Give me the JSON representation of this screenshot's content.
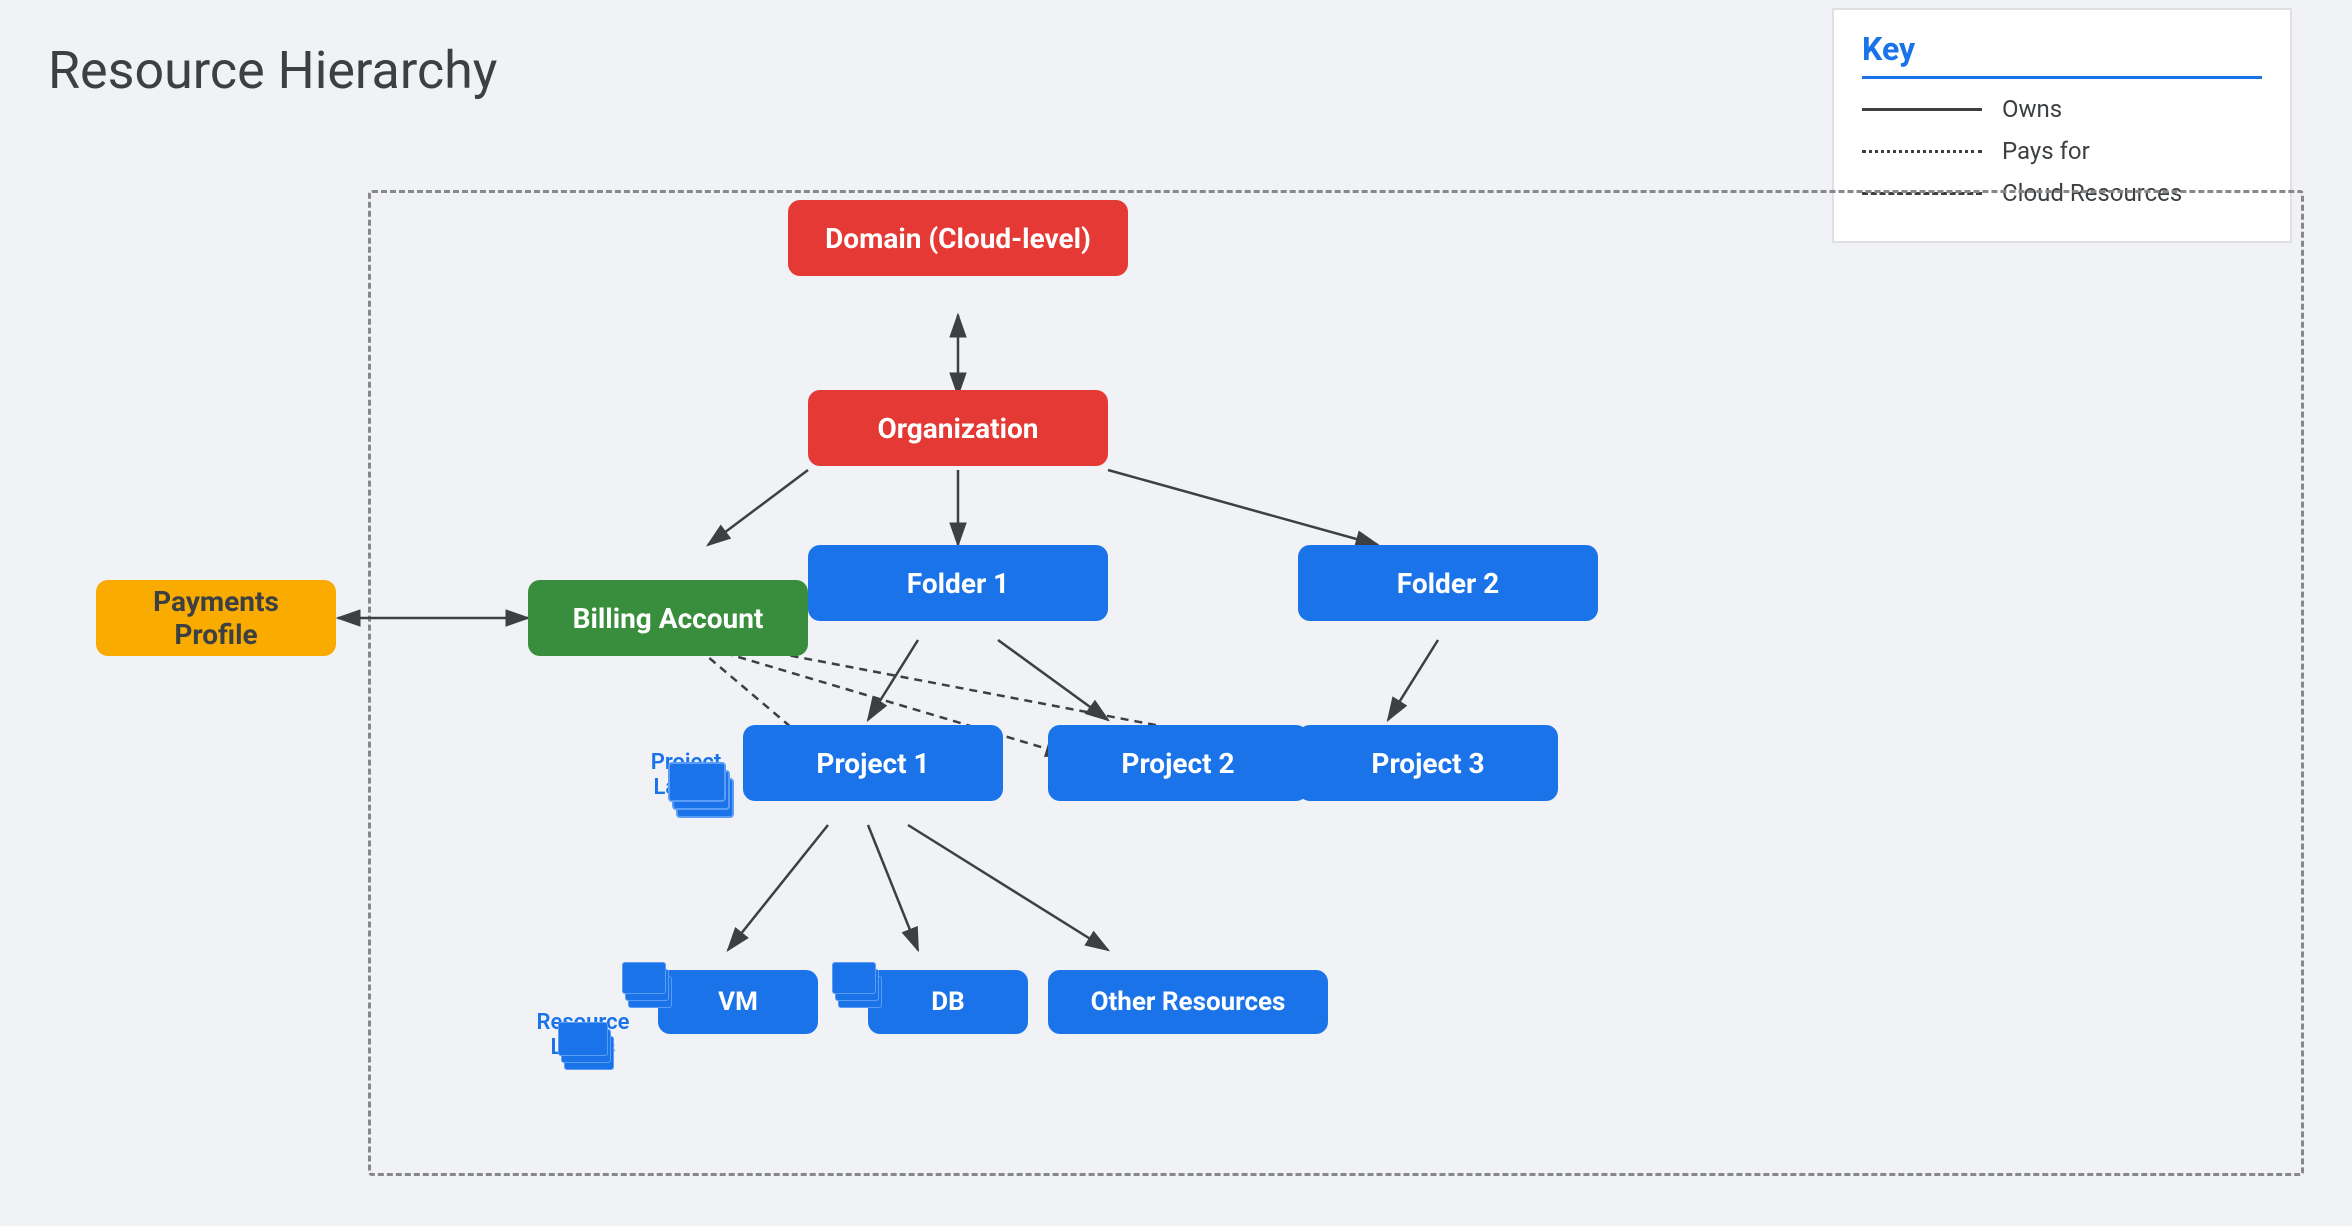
{
  "title": "Resource Hierarchy",
  "key": {
    "heading": "Key",
    "items": [
      {
        "label": "Owns",
        "style": "solid"
      },
      {
        "label": "Pays for",
        "style": "dotted"
      },
      {
        "label": "Cloud Resources",
        "style": "dashed"
      }
    ]
  },
  "nodes": {
    "domain": "Domain (Cloud-level)",
    "organization": "Organization",
    "billing_account": "Billing Account",
    "payments_profile": "Payments Profile",
    "folder1": "Folder 1",
    "folder2": "Folder 2",
    "project1": "Project 1",
    "project2": "Project 2",
    "project3": "Project 3",
    "vm": "VM",
    "db": "DB",
    "other_resources": "Other Resources"
  },
  "labels": {
    "project_labels": "Project\nLabels",
    "resource_labels": "Resource\nLabels"
  }
}
